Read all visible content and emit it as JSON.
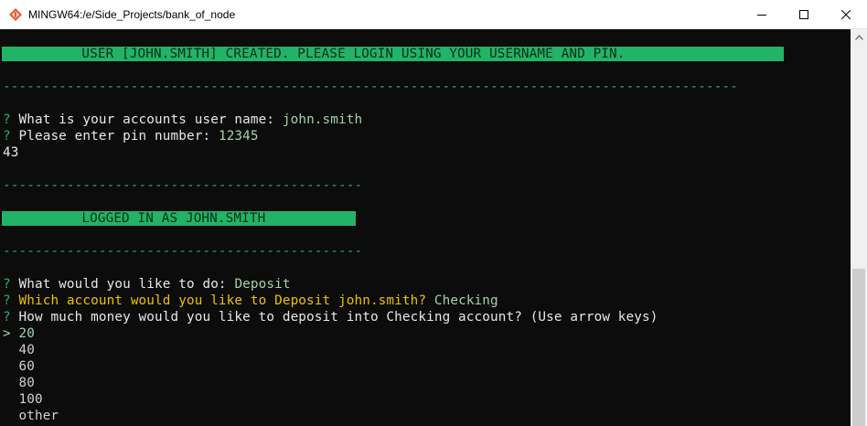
{
  "window": {
    "title": "MINGW64:/e/Side_Projects/bank_of_node",
    "icon": "mingw-app-icon",
    "controls": {
      "minimize": "minimize-icon",
      "maximize": "maximize-icon",
      "close": "close-icon"
    }
  },
  "terminal": {
    "banner_created": "          USER [JOHN.SMITH] CREATED. PLEASE LOGIN USING YOUR USERNAME AND PIN.",
    "separator_long": "--------------------------------------------------------------------------------------------",
    "separator_short": "---------------------------------------------",
    "prompt_mark": "?",
    "q_username": "What is your accounts user name:",
    "a_username": "john.smith",
    "q_pin": "Please enter pin number:",
    "a_pin": "12345",
    "output_43": "43",
    "banner_logged_in": "          LOGGED IN AS JOHN.SMITH",
    "q_action": "What would you like to do:",
    "a_action": "Deposit",
    "q_account": "Which account would you like to Deposit john.smith?",
    "a_account": "Checking",
    "q_amount": "How much money would you like to deposit into Checking account? (Use arrow keys)",
    "cursor": ">",
    "options": [
      "20",
      "40",
      "60",
      "80",
      "100",
      "other"
    ],
    "selected_option": "20"
  },
  "colors": {
    "terminal_bg": "#0c0c0c",
    "accent_green": "#23b366",
    "answer_green": "#9fd6a6",
    "highlight_yellow": "#f0c000",
    "text": "#e8e8e8"
  }
}
